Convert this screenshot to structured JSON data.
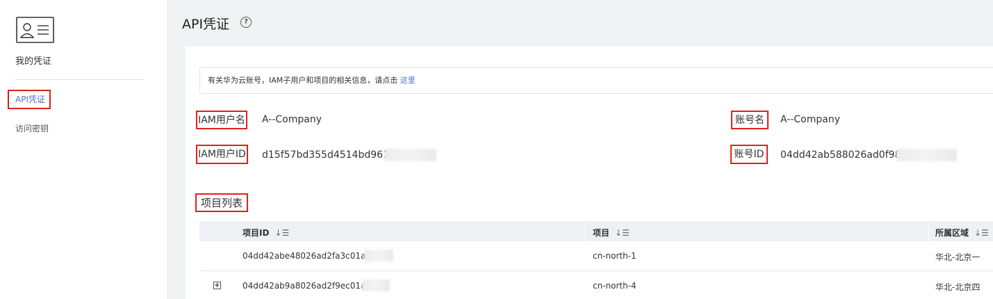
{
  "sidebar": {
    "header_title": "我的凭证",
    "items": [
      {
        "label": "API凭证"
      },
      {
        "label": "访问密钥"
      }
    ]
  },
  "header": {
    "title": "API凭证",
    "help_icon": "?"
  },
  "notice": {
    "text": "有关华为云账号，IAM子用户和项目的相关信息，请点击 ",
    "link": "这里"
  },
  "info": {
    "iam_user_name_label": "IAM用户名",
    "iam_user_name_value": "A--Company",
    "iam_user_id_label": "IAM用户ID",
    "iam_user_id_value": "d15f57bd355d4514bd9618",
    "account_name_label": "账号名",
    "account_name_value": "A--Company",
    "account_id_label": "账号ID",
    "account_id_value": "04dd42ab588026ad0f98c"
  },
  "project_list": {
    "title": "项目列表",
    "columns": [
      "项目ID",
      "项目",
      "所属区域"
    ],
    "sort_icon": "↓☰",
    "rows": [
      {
        "id": "04dd42abe48026ad2fa3c01ad7f",
        "project": "cn-north-1",
        "region": "华北-北京一"
      },
      {
        "id": "04dd42ab9a8026ad2f9ec01a92",
        "project": "cn-north-4",
        "region": "华北-北京四"
      }
    ]
  },
  "icons": {
    "credential_icon": "id-card-icon",
    "expand_icon": "+"
  },
  "colors": {
    "highlight_border": "#e0201a",
    "link": "#526ecc",
    "table_header_bg": "#eef0f4"
  }
}
